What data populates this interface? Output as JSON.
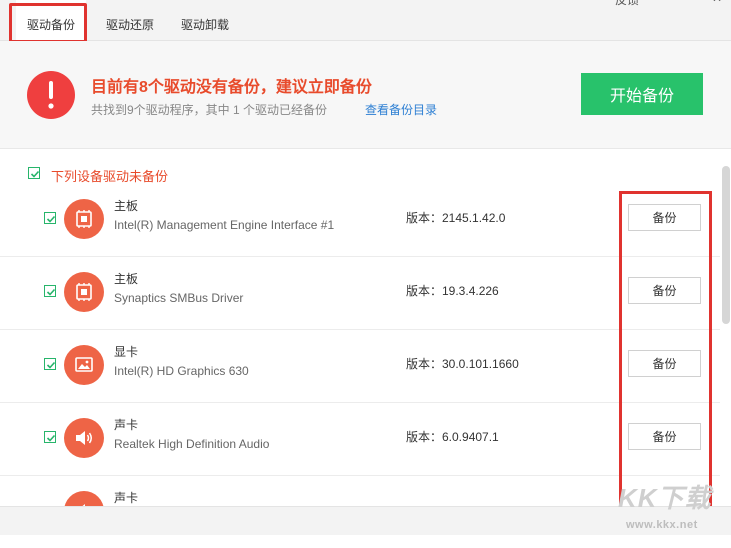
{
  "tabs": [
    {
      "label": "驱动备份",
      "active": true
    },
    {
      "label": "驱动还原",
      "active": false
    },
    {
      "label": "驱动卸载",
      "active": false
    }
  ],
  "window_controls": {
    "feedback": "反馈",
    "minimize": "—",
    "close": "✕"
  },
  "banner": {
    "title": "目前有8个驱动没有备份，建议立即备份",
    "subtitle": "共找到9个驱动程序，其中 1 个驱动已经备份",
    "link": "查看备份目录",
    "button": "开始备份",
    "button_color": "#28c26b"
  },
  "list": {
    "header": "下列设备驱动未备份",
    "header_checked": true,
    "items": [
      {
        "type": "主板",
        "name": "Intel(R) Management Engine Interface #1",
        "version": "版本：2145.1.42.0",
        "button": "备份",
        "checked": true,
        "icon": "motherboard-icon"
      },
      {
        "type": "主板",
        "name": "Synaptics SMBus Driver",
        "version": "版本：19.3.4.226",
        "button": "备份",
        "checked": true,
        "icon": "motherboard-icon"
      },
      {
        "type": "显卡",
        "name": "Intel(R) HD Graphics 630",
        "version": "版本：30.0.101.1660",
        "button": "备份",
        "checked": true,
        "icon": "display-icon"
      },
      {
        "type": "声卡",
        "name": "Realtek High Definition Audio",
        "version": "版本：6.0.9407.1",
        "button": "备份",
        "checked": true,
        "icon": "speaker-icon"
      },
      {
        "type": "声卡",
        "name": "",
        "version": "",
        "button": "",
        "checked": true,
        "icon": "speaker-icon"
      }
    ]
  },
  "watermark": {
    "logo": "KK下载",
    "url": "www.kkx.net"
  }
}
